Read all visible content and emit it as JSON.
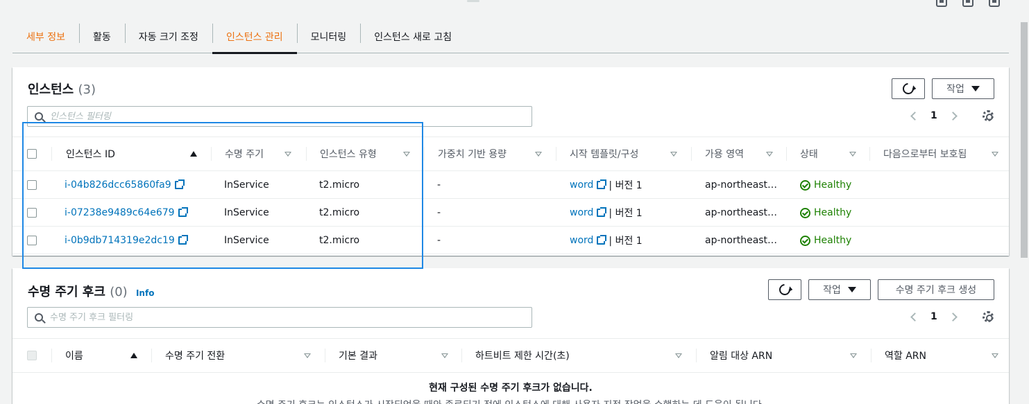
{
  "tabs": [
    {
      "label": "세부 정보",
      "state": "orange"
    },
    {
      "label": "활동",
      "state": ""
    },
    {
      "label": "자동 크기 조정",
      "state": ""
    },
    {
      "label": "인스턴스 관리",
      "state": "active"
    },
    {
      "label": "모니터링",
      "state": ""
    },
    {
      "label": "인스턴스 새로 고침",
      "state": ""
    }
  ],
  "instances": {
    "title": "인스턴스",
    "count": "(3)",
    "actions_label": "작업",
    "filter_placeholder": "인스턴스 필터링",
    "page": "1",
    "columns": [
      "인스턴스 ID",
      "수명 주기",
      "인스턴스 유형",
      "가중치 기반 용량",
      "시작 템플릿/구성",
      "가용 영역",
      "상태",
      "다음으로부터 보호됨"
    ],
    "rows": [
      {
        "id": "i-04b826dcc65860fa9",
        "lifecycle": "InService",
        "type": "t2.micro",
        "weight": "-",
        "template": "word",
        "version": "| 버전 1",
        "az": "ap-northeast…",
        "status": "Healthy"
      },
      {
        "id": "i-07238e9489c64e679",
        "lifecycle": "InService",
        "type": "t2.micro",
        "weight": "-",
        "template": "word",
        "version": "| 버전 1",
        "az": "ap-northeast…",
        "status": "Healthy"
      },
      {
        "id": "i-0b9db714319e2dc19",
        "lifecycle": "InService",
        "type": "t2.micro",
        "weight": "-",
        "template": "word",
        "version": "| 버전 1",
        "az": "ap-northeast…",
        "status": "Healthy"
      }
    ]
  },
  "hooks": {
    "title": "수명 주기 후크",
    "count": "(0)",
    "info": "Info",
    "actions_label": "작업",
    "create_label": "수명 주기 후크 생성",
    "filter_placeholder": "수명 주기 후크 필터링",
    "page": "1",
    "columns": [
      "이름",
      "수명 주기 전환",
      "기본 결과",
      "하트비트 제한 시간(초)",
      "알림 대상 ARN",
      "역할 ARN"
    ],
    "empty_title": "현재 구성된 수명 주기 후크가 없습니다.",
    "empty_desc": "수명 주기 후크는 인스턴스가 시작되었을 때와 종료되기 전에 인스턴스에 대해 사용자 지정 작업을 수행하는 데 도움이 됩니다."
  },
  "colors": {
    "accent": "#ec7211",
    "link": "#0073bb",
    "healthy": "#1d8102",
    "highlight": "#1e88e5"
  }
}
